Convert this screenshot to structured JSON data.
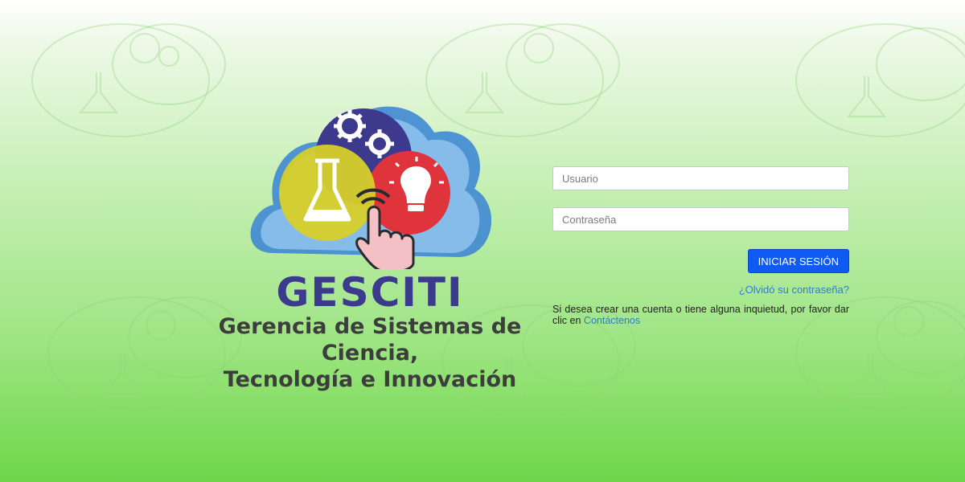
{
  "brand": {
    "name": "GESCITI",
    "subtitle_line1": "Gerencia de Sistemas de Ciencia,",
    "subtitle_line2": "Tecnología e Innovación"
  },
  "login": {
    "username_placeholder": "Usuario",
    "password_placeholder": "Contraseña",
    "submit_label": "INICIAR SESIÓN",
    "forgot_label": "¿Olvidó su contraseña?",
    "help_text": "Si desea crear una cuenta o tiene alguna inquietud, por favor dar clic en",
    "contact_label": "Contáctenos"
  },
  "colors": {
    "accent": "#0f5af0",
    "link": "#2f7fc2",
    "brand_text": "#3b3a8c",
    "background_top": "#ffffff",
    "background_bottom": "#6fd64a"
  },
  "icons": [
    "flask-icon",
    "gears-icon",
    "lightbulb-icon",
    "pointing-hand-icon",
    "cloud-shape"
  ]
}
